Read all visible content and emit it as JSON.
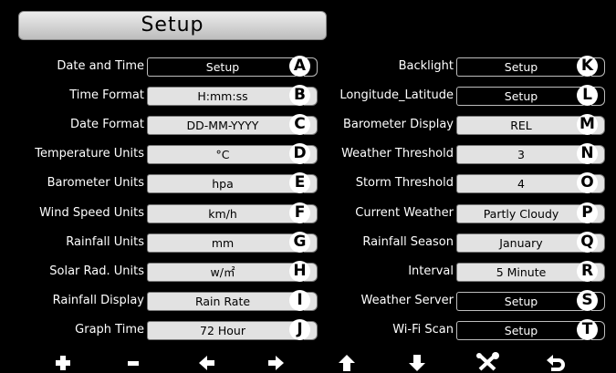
{
  "title": "Setup",
  "left_column": [
    {
      "label": "Date and Time",
      "value": "Setup",
      "key": "A",
      "style": "plain"
    },
    {
      "label": "Time Format",
      "value": "H:mm:ss",
      "key": "B",
      "style": "grey"
    },
    {
      "label": "Date Format",
      "value": "DD-MM-YYYY",
      "key": "C",
      "style": "grey"
    },
    {
      "label": "Temperature Units",
      "value": "°C",
      "key": "D",
      "style": "grey"
    },
    {
      "label": "Barometer Units",
      "value": "hpa",
      "key": "E",
      "style": "grey"
    },
    {
      "label": "Wind Speed Units",
      "value": "km/h",
      "key": "F",
      "style": "grey"
    },
    {
      "label": "Rainfall Units",
      "value": "mm",
      "key": "G",
      "style": "grey"
    },
    {
      "label": "Solar Rad. Units",
      "value": "w/㎡",
      "key": "H",
      "style": "grey"
    },
    {
      "label": "Rainfall Display",
      "value": "Rain Rate",
      "key": "I",
      "style": "grey"
    },
    {
      "label": "Graph  Time",
      "value": "72 Hour",
      "key": "J",
      "style": "grey"
    }
  ],
  "right_column": [
    {
      "label": "Backlight",
      "value": "Setup",
      "key": "K",
      "style": "plain"
    },
    {
      "label": "Longitude_Latitude",
      "value": "Setup",
      "key": "L",
      "style": "plain"
    },
    {
      "label": "Barometer Display",
      "value": "REL",
      "key": "M",
      "style": "grey"
    },
    {
      "label": "Weather Threshold",
      "value": "3",
      "key": "N",
      "style": "grey"
    },
    {
      "label": "Storm Threshold",
      "value": "4",
      "key": "O",
      "style": "grey"
    },
    {
      "label": "Current Weather",
      "value": "Partly Cloudy",
      "key": "P",
      "style": "grey"
    },
    {
      "label": "Rainfall Season",
      "value": "January",
      "key": "Q",
      "style": "grey"
    },
    {
      "label": "Interval",
      "value": "5 Minute",
      "key": "R",
      "style": "grey"
    },
    {
      "label": "Weather Server",
      "value": "Setup",
      "key": "S",
      "style": "plain"
    },
    {
      "label": "Wi-Fi Scan",
      "value": "Setup",
      "key": "T",
      "style": "plain"
    }
  ],
  "toolbar": [
    {
      "icon": "plus-icon"
    },
    {
      "icon": "minus-icon"
    },
    {
      "icon": "arrow-left-icon"
    },
    {
      "icon": "arrow-right-icon"
    },
    {
      "icon": "arrow-up-icon"
    },
    {
      "icon": "arrow-down-icon"
    },
    {
      "icon": "tools-icon"
    },
    {
      "icon": "return-icon"
    }
  ]
}
